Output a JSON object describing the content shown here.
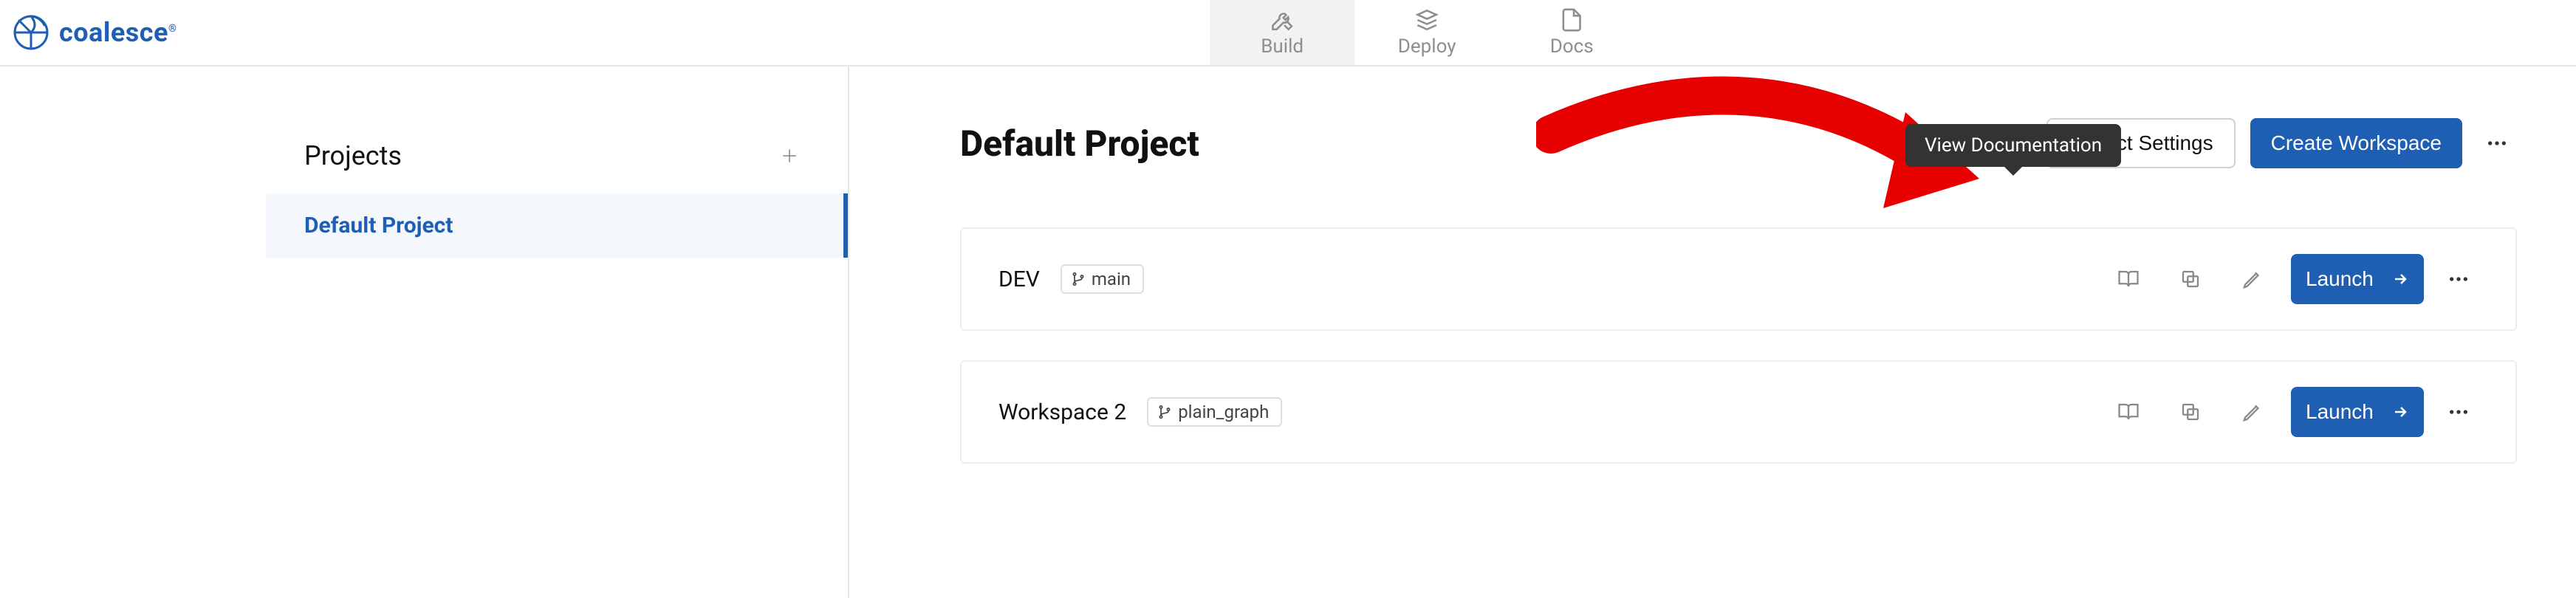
{
  "brand": {
    "name": "coalesce"
  },
  "nav": {
    "build": {
      "label": "Build"
    },
    "deploy": {
      "label": "Deploy"
    },
    "docs": {
      "label": "Docs"
    }
  },
  "sidebar": {
    "header": "Projects",
    "items": [
      {
        "name": "Default Project",
        "active": true
      }
    ]
  },
  "project": {
    "title": "Default Project",
    "settings_btn": "Project Settings",
    "create_btn": "Create Workspace"
  },
  "tooltip": {
    "view_docs": "View Documentation"
  },
  "workspaces": [
    {
      "name": "DEV",
      "branch": "main"
    },
    {
      "name": "Workspace 2",
      "branch": "plain_graph"
    }
  ],
  "actions": {
    "launch": "Launch"
  }
}
